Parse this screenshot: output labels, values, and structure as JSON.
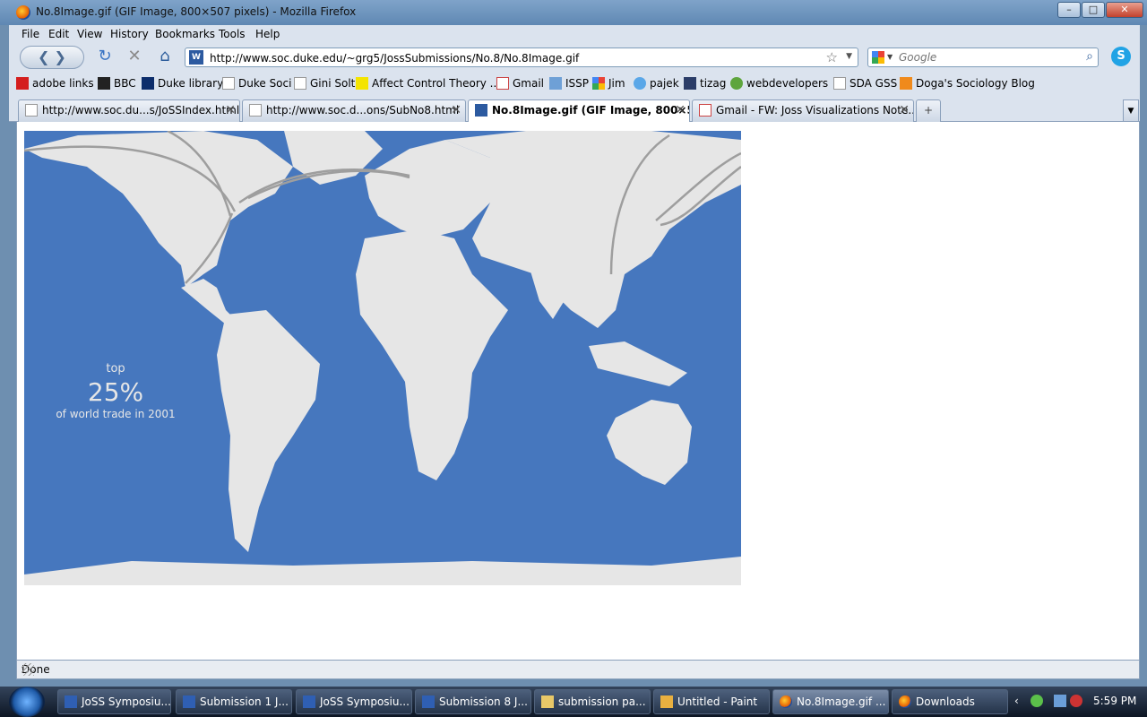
{
  "window": {
    "title": "No.8Image.gif (GIF Image, 800×507 pixels) - Mozilla Firefox",
    "min_label": "–",
    "max_label": "□",
    "close_label": "✕"
  },
  "menu": [
    "File",
    "Edit",
    "View",
    "History",
    "Bookmarks",
    "Tools",
    "Help"
  ],
  "nav": {
    "back_label": "❮ ❯",
    "reload_label": "↻",
    "stop_label": "✕",
    "home_label": "⌂",
    "url": "http://www.soc.duke.edu/~grg5/JossSubmissions/No.8/No.8Image.gif",
    "search_placeholder": "Google"
  },
  "bookmarks": [
    "adobe links",
    "BBC",
    "Duke library",
    "Duke Soci",
    "Gini Solt",
    "Affect Control Theory ...",
    "Gmail",
    "ISSP",
    "Jim",
    "pajek",
    "tizag",
    "webdevelopers",
    "SDA GSS",
    "Doga's Sociology Blog"
  ],
  "tabs": [
    {
      "label": "http://www.soc.du...s/JoSSIndex.html"
    },
    {
      "label": "http://www.soc.d...ons/SubNo8.html"
    },
    {
      "label": "No.8Image.gif (GIF Image, 800×5..."
    },
    {
      "label": "Gmail - FW: Joss Visualizations Note..."
    }
  ],
  "map": {
    "caption_top": "top",
    "caption_pct": "25%",
    "caption_bottom": "of world trade in 2001",
    "colors": {
      "ocean": "#4677be",
      "land": "#e6e6e6",
      "flow": "#9e9e9e"
    }
  },
  "status": {
    "text": "Done"
  },
  "taskbar": {
    "items": [
      "JoSS Symposiu...",
      "Submission 1 J...",
      "JoSS Symposiu...",
      "Submission 8 J...",
      "submission pa...",
      "Untitled - Paint",
      "No.8Image.gif ...",
      "Downloads"
    ],
    "clock": "5:59 PM"
  }
}
